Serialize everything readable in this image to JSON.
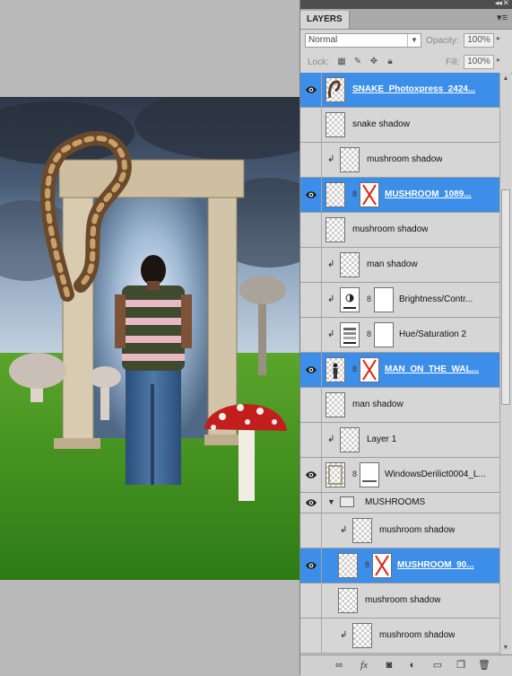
{
  "panel": {
    "tab_label": "LAYERS",
    "menu_icon": "panel-menu-icon",
    "collapse_icon": "collapse-arrows-icon"
  },
  "blend": {
    "mode": "Normal",
    "opacity_label": "Opacity:",
    "opacity_value": "100%",
    "fill_label": "Fill:",
    "fill_value": "100%",
    "lock_label": "Lock:"
  },
  "layers": [
    {
      "name": "SNAKE_Photoxpress_2424...",
      "visible": true,
      "selected": true,
      "clipped": false,
      "thumb": "snake",
      "mask": false
    },
    {
      "name": "snake shadow",
      "visible": false,
      "selected": false,
      "clipped": false,
      "thumb": "transparent",
      "mask": false
    },
    {
      "name": "mushroom shadow",
      "visible": false,
      "selected": false,
      "clipped": true,
      "thumb": "transparent",
      "mask": false
    },
    {
      "name": "MUSHROOM_1089...",
      "visible": true,
      "selected": true,
      "clipped": false,
      "thumb": "transparent",
      "mask": "x"
    },
    {
      "name": "mushroom shadow",
      "visible": false,
      "selected": false,
      "clipped": false,
      "thumb": "transparent",
      "mask": false
    },
    {
      "name": "man shadow",
      "visible": false,
      "selected": false,
      "clipped": true,
      "thumb": "transparent",
      "mask": false
    },
    {
      "name": "Brightness/Contr...",
      "visible": false,
      "selected": false,
      "clipped": true,
      "thumb": "brightness",
      "mask": "white"
    },
    {
      "name": "Hue/Saturation 2",
      "visible": false,
      "selected": false,
      "clipped": true,
      "thumb": "huesat",
      "mask": "white"
    },
    {
      "name": "MAN_ON_THE_WAL...",
      "visible": true,
      "selected": true,
      "clipped": false,
      "thumb": "man",
      "mask": "x"
    },
    {
      "name": "man shadow",
      "visible": false,
      "selected": false,
      "clipped": false,
      "thumb": "transparent",
      "mask": false
    },
    {
      "name": "Layer 1",
      "visible": false,
      "selected": false,
      "clipped": true,
      "thumb": "transparent",
      "mask": false
    },
    {
      "name": "WindowsDerilict0004_L...",
      "visible": true,
      "selected": false,
      "clipped": false,
      "thumb": "window",
      "mask": "line"
    }
  ],
  "group": {
    "name": "MUSHROOMS",
    "visible": true
  },
  "group_layers": [
    {
      "name": "mushroom shadow",
      "visible": false,
      "selected": false,
      "clipped": true,
      "thumb": "transparent",
      "mask": false
    },
    {
      "name": "MUSHROOM_90...",
      "visible": true,
      "selected": true,
      "clipped": false,
      "thumb": "transparent",
      "mask": "x"
    },
    {
      "name": "mushroom shadow",
      "visible": false,
      "selected": false,
      "clipped": false,
      "thumb": "transparent",
      "mask": false
    },
    {
      "name": "mushroom shadow",
      "visible": false,
      "selected": false,
      "clipped": true,
      "thumb": "transparent",
      "mask": false
    }
  ],
  "bottom_icons": [
    "link-layers-icon",
    "fx-icon",
    "add-mask-icon",
    "adjustment-layer-icon",
    "new-group-icon",
    "new-layer-icon",
    "trash-icon"
  ],
  "colors": {
    "selection": "#3d8ee8",
    "panel_bg": "#d6d6d6",
    "canvas_bg": "#b9b9b9"
  }
}
